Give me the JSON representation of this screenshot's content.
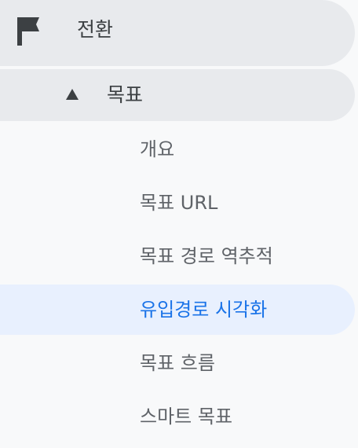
{
  "section": {
    "label": "전환",
    "icon": "flag-icon"
  },
  "subsection": {
    "label": "목표",
    "icon": "caret-up-icon",
    "expanded": true
  },
  "items": [
    {
      "label": "개요",
      "active": false
    },
    {
      "label": "목표 URL",
      "active": false
    },
    {
      "label": "목표 경로 역추적",
      "active": false
    },
    {
      "label": "유입경로 시각화",
      "active": true
    },
    {
      "label": "목표 흐름",
      "active": false
    },
    {
      "label": "스마트 목표",
      "active": false
    }
  ],
  "colors": {
    "active_text": "#1a73e8",
    "active_bg": "#e8f0fe",
    "section_bg": "#e8eaed",
    "text": "#5f6368",
    "icon": "#3c4043"
  }
}
